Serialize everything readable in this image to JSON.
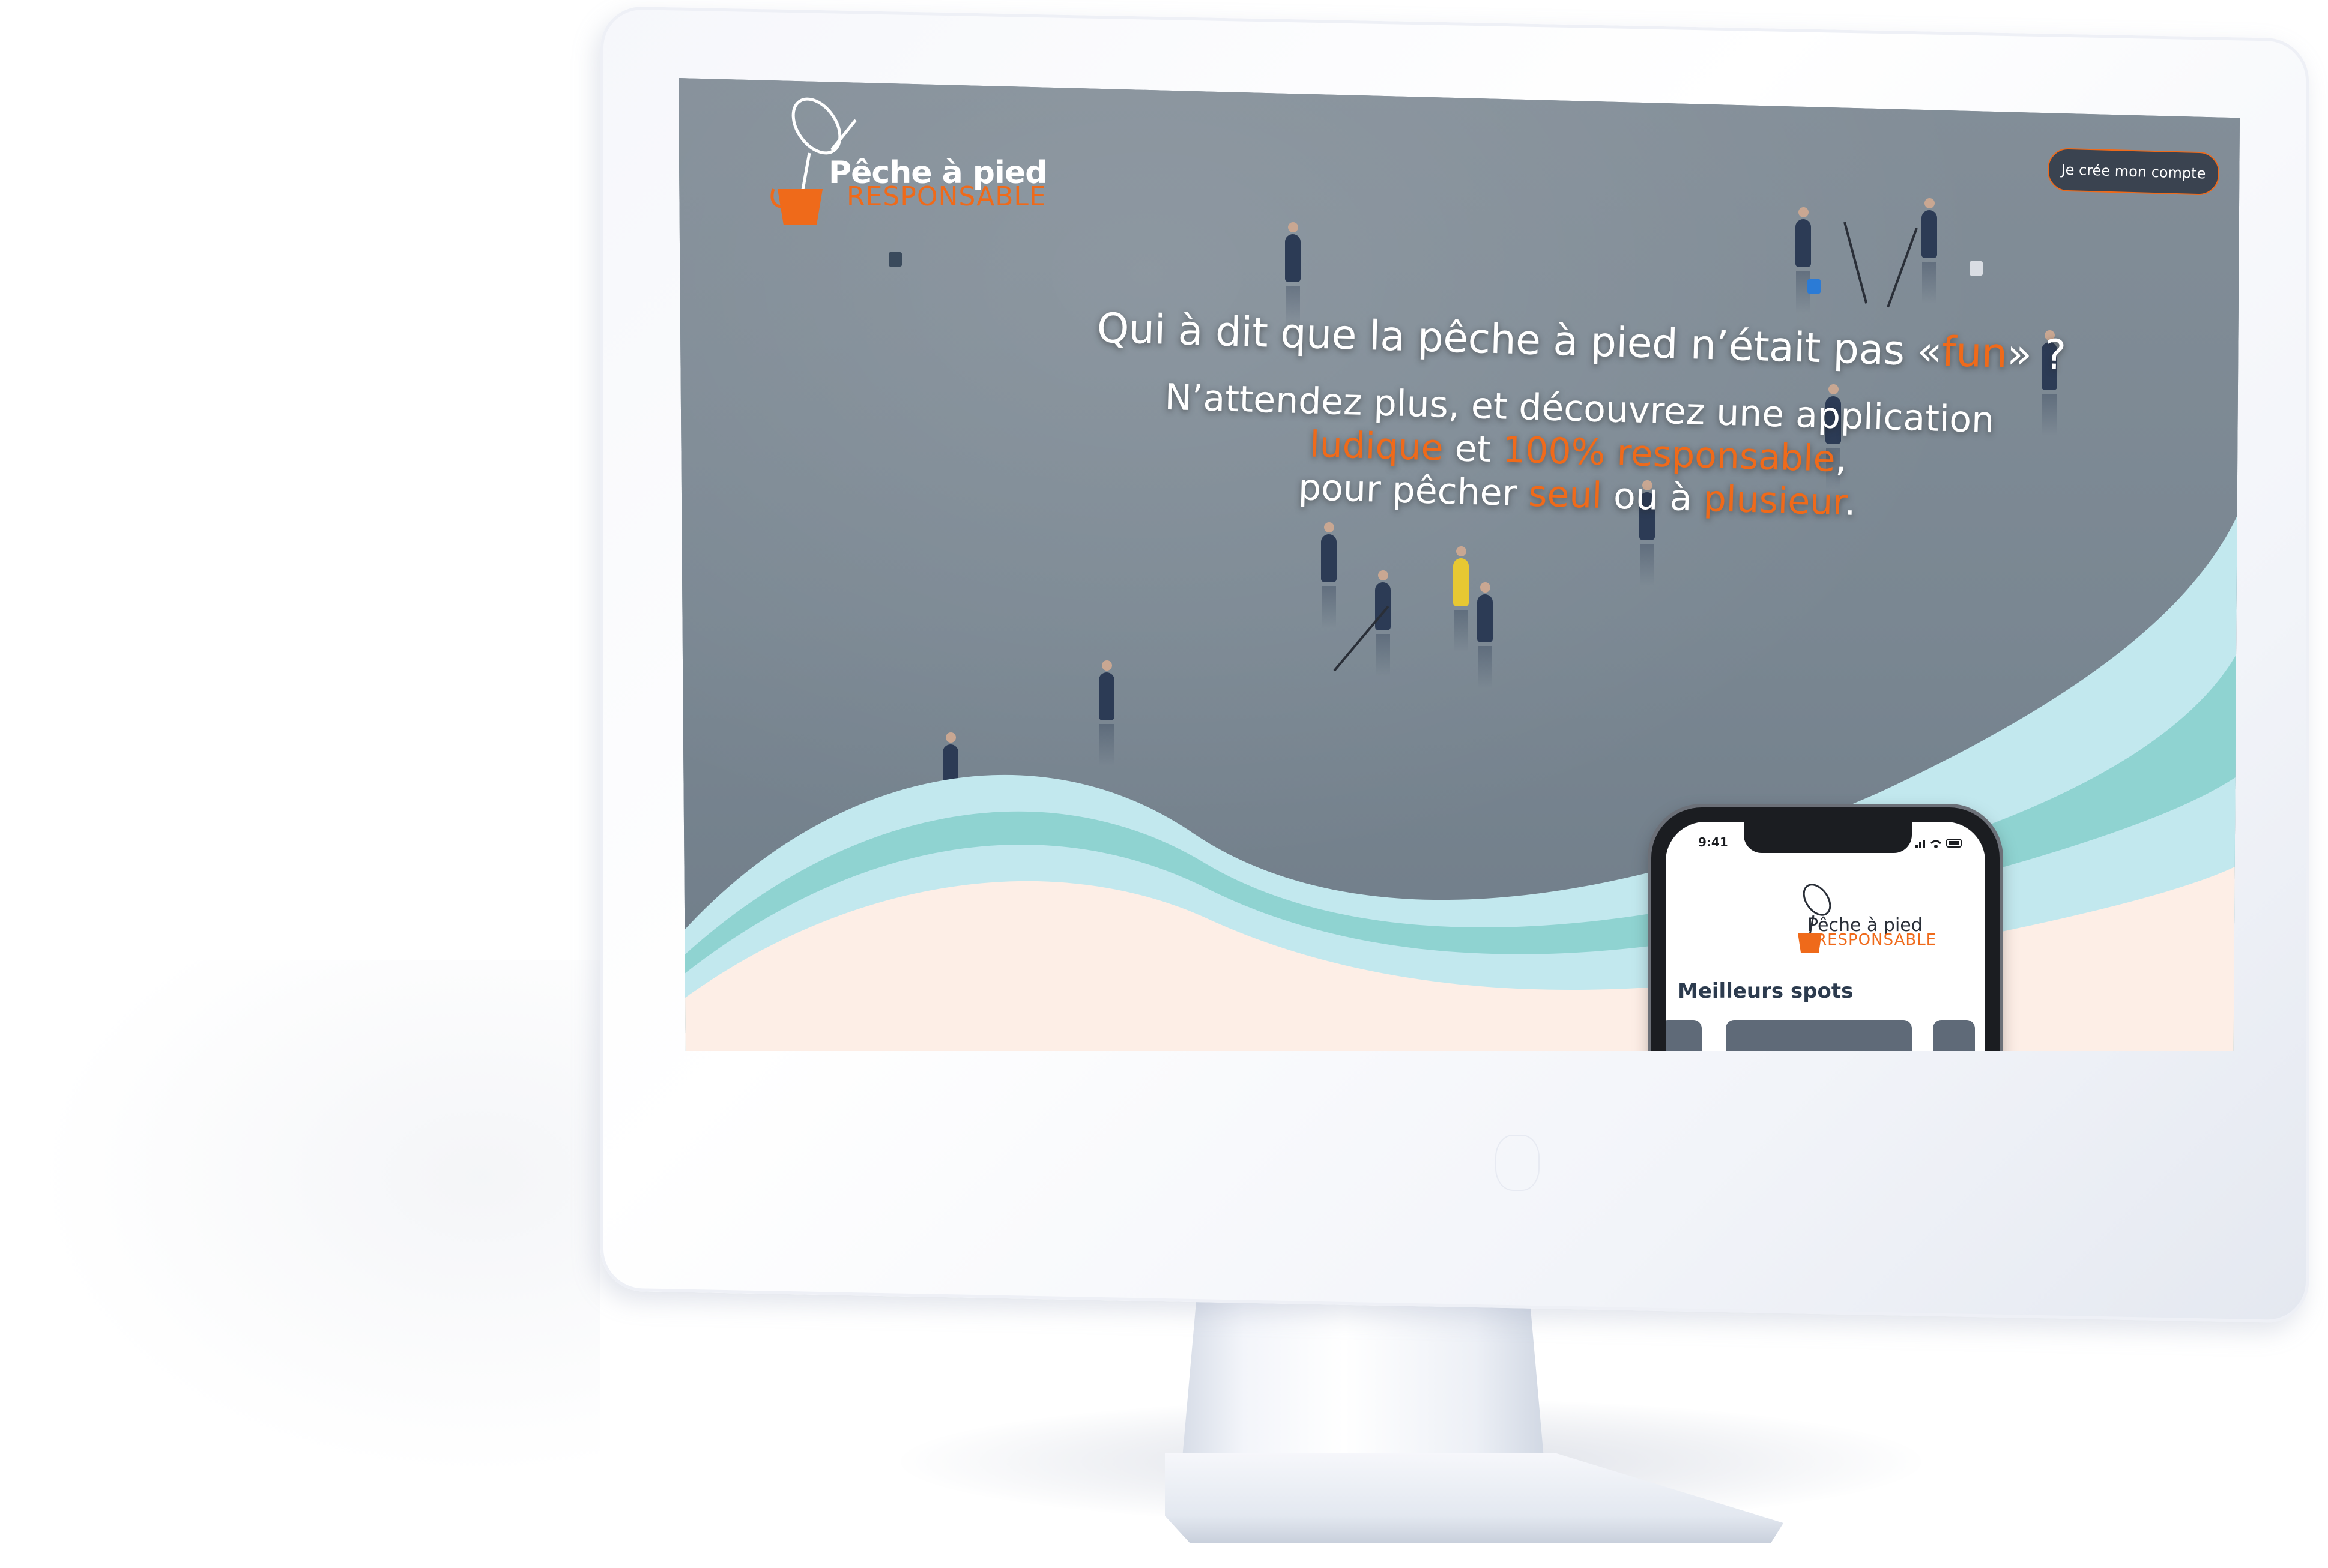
{
  "brand": {
    "title": "Pêche à pied",
    "subtitle": "RESPONSABLE"
  },
  "header": {
    "cta_label": "Je crée mon compte"
  },
  "hero": {
    "headline_before": "Qui à dit que la pêche à pied n’était pas «",
    "headline_highlight": "fun",
    "headline_after": "» ?",
    "line1": "N’attendez plus, et découvrez une application",
    "line2_h1": "ludique",
    "line2_mid": " et ",
    "line2_h2": "100% responsable",
    "line2_end": ",",
    "line3_start": "pour pêcher ",
    "line3_h1": "seul",
    "line3_mid": " ou à ",
    "line3_h2": "plusieur",
    "line3_end": "."
  },
  "phone": {
    "time": "9:41",
    "status_icons": "signal-icon wifi-icon battery-icon",
    "section_title": "Meilleurs spots"
  },
  "colors": {
    "accent": "#ef6a1a",
    "wave_light": "#c2e8ee",
    "wave_teal": "#8fd3d1",
    "sand": "#fdeee6",
    "button_bg": "#3a4350"
  }
}
